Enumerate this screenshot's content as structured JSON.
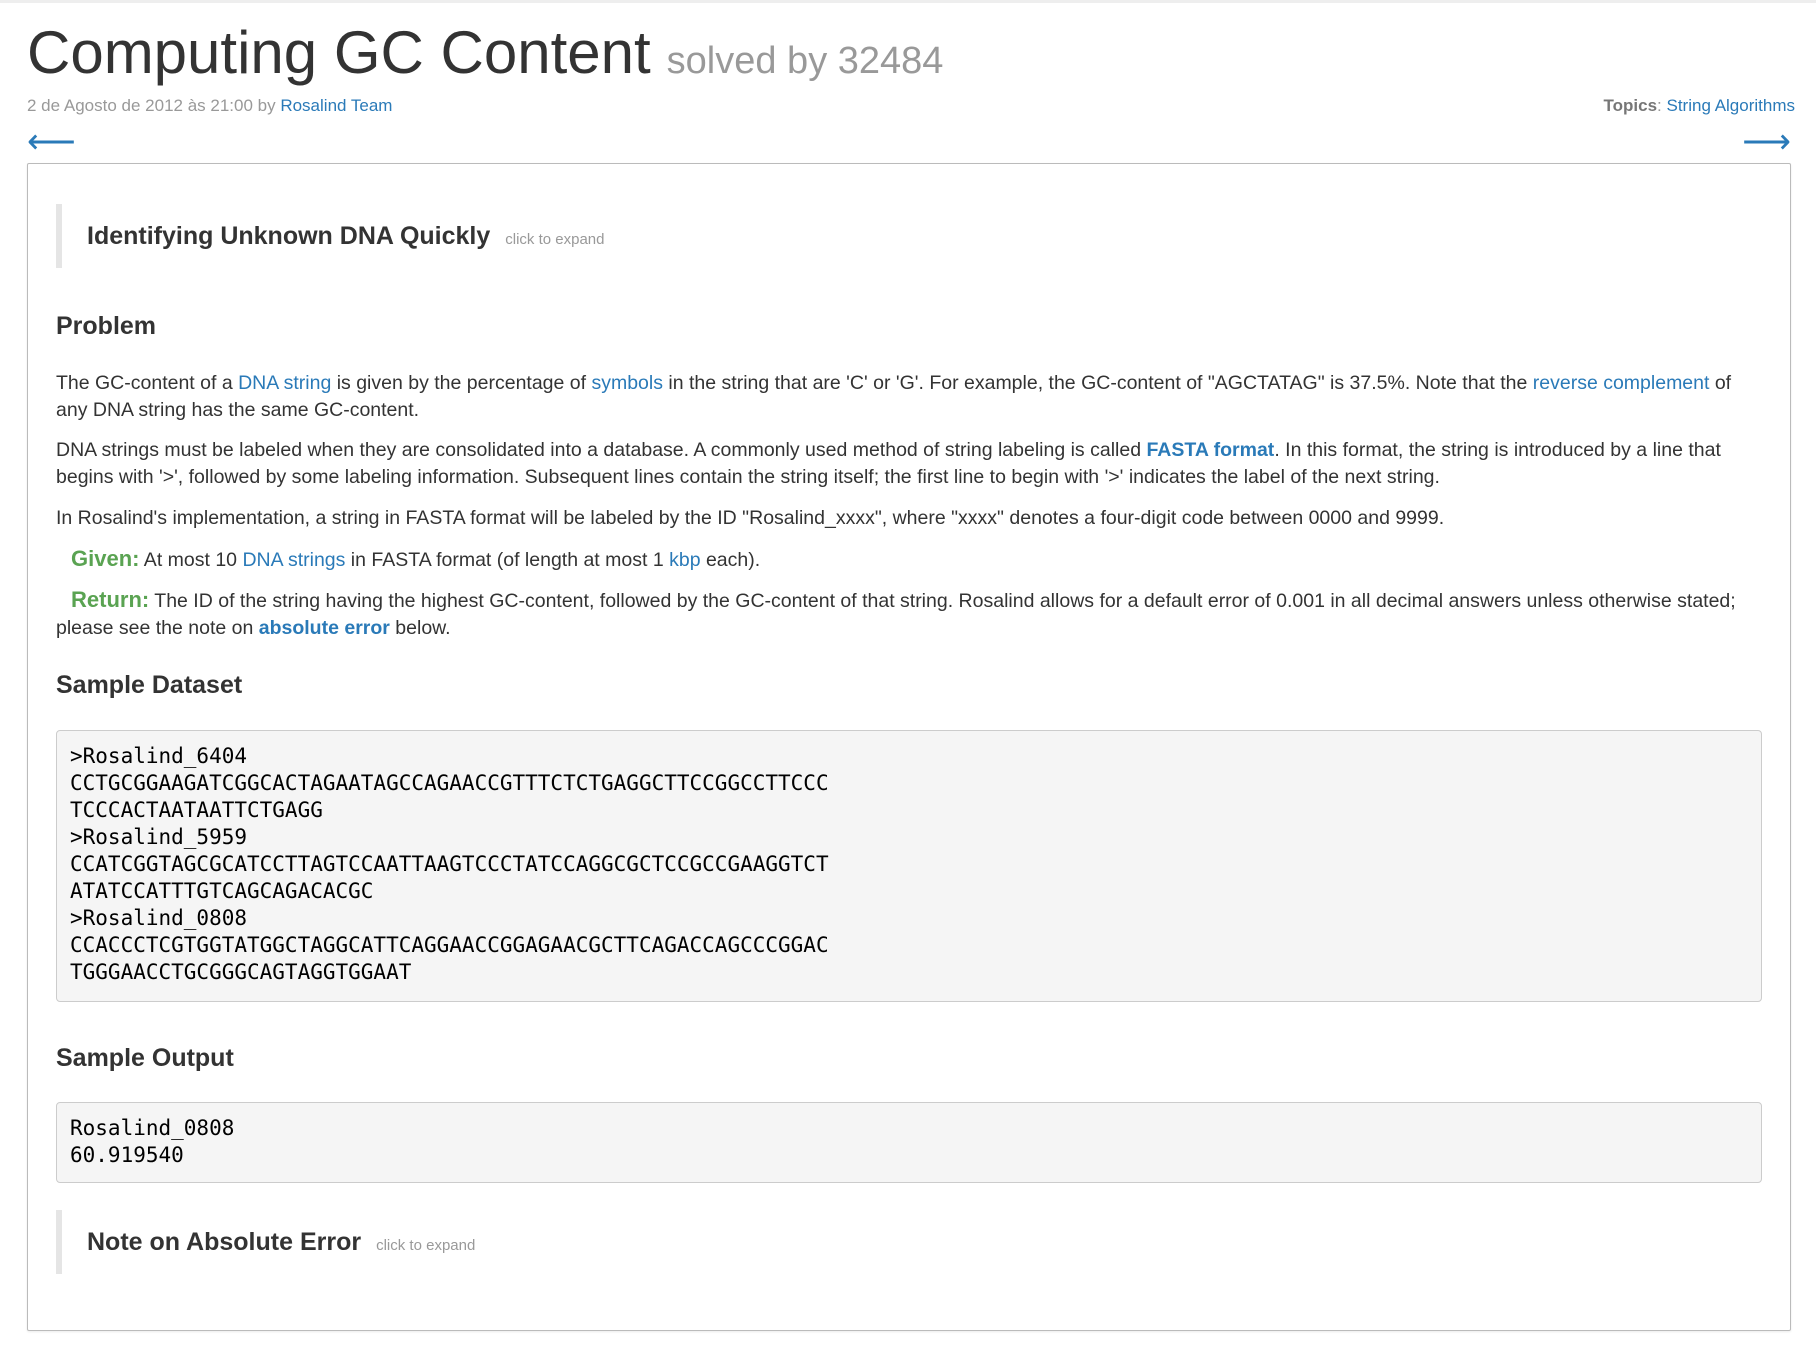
{
  "header": {
    "title": "Computing GC Content",
    "solved": "solved by 32484",
    "date": "2 de Agosto de 2012 às 21:00 by",
    "author": "Rosalind Team",
    "topics_label": "Topics",
    "topics_sep": ":",
    "topic": "String Algorithms"
  },
  "nav": {
    "prev": "⟵",
    "next": "⟶"
  },
  "intro_collapse": {
    "title": "Identifying Unknown DNA Quickly",
    "hint": "click to expand"
  },
  "problem": {
    "heading": "Problem",
    "p1": {
      "t1": "The GC-content of a ",
      "l1": "DNA string",
      "t2": " is given by the percentage of ",
      "l2": "symbols",
      "t3": " in the string that are 'C' or 'G'. For example, the GC-content of \"AGCTATAG\" is 37.5%. Note that the ",
      "l3": "reverse complement",
      "t4": " of any DNA string has the same GC-content."
    },
    "p2": {
      "t1": "DNA strings must be labeled when they are consolidated into a database. A commonly used method of string labeling is called ",
      "l1": "FASTA format",
      "t2": ". In this format, the string is introduced by a line that begins with '>', followed by some labeling information. Subsequent lines contain the string itself; the first line to begin with '>' indicates the label of the next string."
    },
    "p3": "In Rosalind's implementation, a string in FASTA format will be labeled by the ID \"Rosalind_xxxx\", where \"xxxx\" denotes a four-digit code between 0000 and 9999.",
    "given": {
      "label": "Given:",
      "t1": " At most 10 ",
      "l1": "DNA strings",
      "t2": " in FASTA format (of length at most 1 ",
      "l2": "kbp",
      "t3": " each)."
    },
    "return": {
      "label": "Return:",
      "t1": " The ID of the string having the highest GC-content, followed by the GC-content of that string. Rosalind allows for a default error of 0.001 in all decimal answers unless otherwise stated; please see the note on ",
      "l1": "absolute error",
      "t2": " below."
    }
  },
  "sample_dataset": {
    "heading": "Sample Dataset",
    "code": ">Rosalind_6404\nCCTGCGGAAGATCGGCACTAGAATAGCCAGAACCGTTTCTCTGAGGCTTCCGGCCTTCCC\nTCCCACTAATAATTCTGAGG\n>Rosalind_5959\nCCATCGGTAGCGCATCCTTAGTCCAATTAAGTCCCTATCCAGGCGCTCCGCCGAAGGTCT\nATATCCATTTGTCAGCAGACACGC\n>Rosalind_0808\nCCACCCTCGTGGTATGGCTAGGCATTCAGGAACCGGAGAACGCTTCAGACCAGCCCGGAC\nTGGGAACCTGCGGGCAGTAGGTGGAAT"
  },
  "sample_output": {
    "heading": "Sample Output",
    "code": "Rosalind_0808\n60.919540"
  },
  "note_collapse": {
    "title": "Note on Absolute Error",
    "hint": "click to expand"
  },
  "colors": {
    "link": "#2a7ab8",
    "given_return": "#5aa352",
    "muted": "#999999",
    "code_bg": "#f5f5f5"
  }
}
